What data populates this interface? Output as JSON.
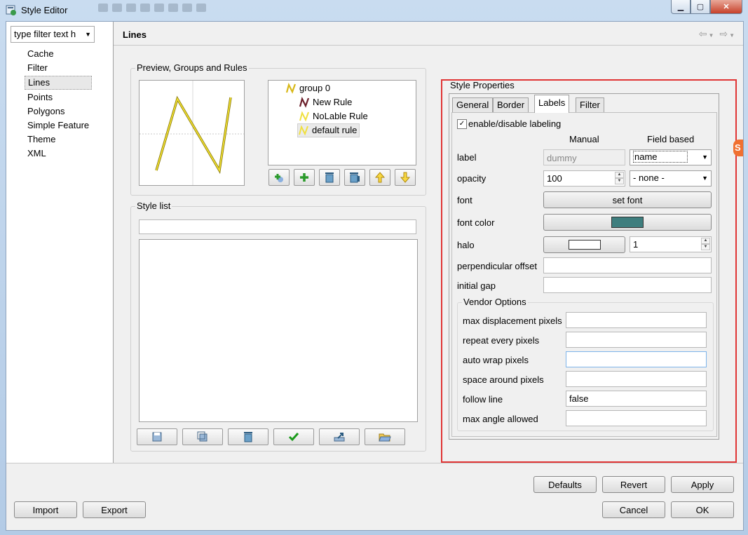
{
  "window": {
    "title": "Style Editor"
  },
  "sidebar": {
    "filter_text": "type filter text h",
    "items": [
      {
        "label": "Cache"
      },
      {
        "label": "Filter"
      },
      {
        "label": "Lines",
        "selected": true
      },
      {
        "label": "Points"
      },
      {
        "label": "Polygons"
      },
      {
        "label": "Simple Feature"
      },
      {
        "label": "Theme"
      },
      {
        "label": "XML"
      }
    ]
  },
  "page": {
    "title": "Lines"
  },
  "preview_group": {
    "label": "Preview, Groups and Rules",
    "tree": {
      "group": "group 0",
      "rules": [
        "New Rule",
        "NoLable Rule",
        "default rule"
      ]
    }
  },
  "style_list": {
    "label": "Style list",
    "search_value": ""
  },
  "style_properties": {
    "label": "Style Properties",
    "tabs": [
      "General",
      "Border",
      "Labels",
      "Filter"
    ],
    "active_tab": "Labels",
    "enable_labeling": "enable/disable labeling",
    "col_manual": "Manual",
    "col_field": "Field based",
    "label_label": "label",
    "label_value": "dummy",
    "label_field": "name",
    "opacity_label": "opacity",
    "opacity_value": "100",
    "opacity_field": "- none -",
    "font_label": "font",
    "font_button": "set font",
    "font_color_label": "font color",
    "font_color_hex": "#3e7e7e",
    "halo_label": "halo",
    "halo_value": "1",
    "perp_offset_label": "perpendicular offset",
    "initial_gap_label": "initial gap",
    "vendor": {
      "label": "Vendor Options",
      "rows": [
        {
          "label": "max displacement pixels",
          "value": ""
        },
        {
          "label": "repeat every pixels",
          "value": ""
        },
        {
          "label": "auto wrap pixels",
          "value": ""
        },
        {
          "label": "space around pixels",
          "value": ""
        },
        {
          "label": "follow line",
          "value": "false"
        },
        {
          "label": "max angle allowed",
          "value": ""
        }
      ]
    }
  },
  "footer": {
    "defaults": "Defaults",
    "revert": "Revert",
    "apply": "Apply",
    "import": "Import",
    "export": "Export",
    "cancel": "Cancel",
    "ok": "OK"
  },
  "colors": {
    "highlight": "#e03434",
    "rule_icon_yellow": "#e8cf2a",
    "rule_icon_dark": "#6b1f2a"
  }
}
